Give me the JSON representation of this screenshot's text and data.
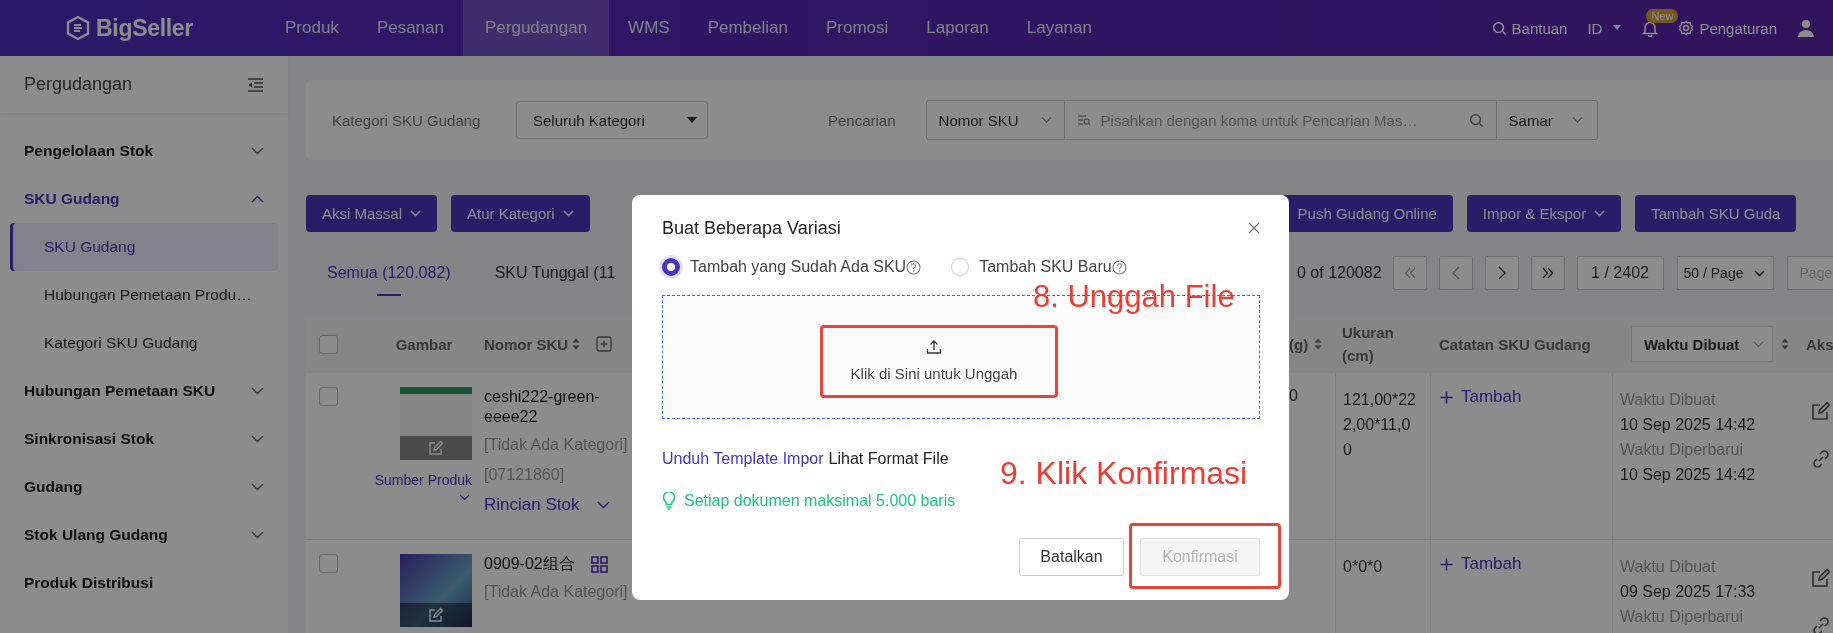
{
  "nav": {
    "logo": "BigSeller",
    "items": [
      {
        "label": "Produk",
        "selected": false
      },
      {
        "label": "Pesanan",
        "selected": false
      },
      {
        "label": "Pergudangan",
        "selected": true
      },
      {
        "label": "WMS",
        "selected": false
      },
      {
        "label": "Pembelian",
        "selected": false
      },
      {
        "label": "Promosi",
        "selected": false
      },
      {
        "label": "Laporan",
        "selected": false
      },
      {
        "label": "Layanan",
        "selected": false
      }
    ],
    "help": "Bantuan",
    "language": "ID",
    "notification_badge": "New",
    "settings": "Pengaturan"
  },
  "sidebar": {
    "title": "Pergudangan",
    "items": [
      {
        "kind": "group",
        "label": "Pengelolaan Stok",
        "expanded": false
      },
      {
        "kind": "group",
        "label": "SKU Gudang",
        "expanded": true,
        "children": [
          {
            "label": "SKU Gudang",
            "selected": true
          },
          {
            "label": "Hubungan Pemetaan Produ…",
            "selected": false
          },
          {
            "label": "Kategori SKU Gudang",
            "selected": false
          }
        ]
      },
      {
        "kind": "group",
        "label": "Hubungan Pemetaan SKU",
        "expanded": false
      },
      {
        "kind": "group",
        "label": "Sinkronisasi Stok",
        "expanded": false
      },
      {
        "kind": "group",
        "label": "Gudang",
        "expanded": false
      },
      {
        "kind": "group",
        "label": "Stok Ulang Gudang",
        "expanded": false
      },
      {
        "kind": "link",
        "label": "Produk Distribusi"
      }
    ]
  },
  "filters": {
    "category_label": "Kategori SKU Gudang",
    "category_value": "Seluruh Kategori",
    "search_label": "Pencarian",
    "search_field": "Nomor SKU",
    "search_placeholder": "Pisahkan dengan koma untuk Pencarian Mas…",
    "match_mode": "Samar"
  },
  "toolbar": {
    "left": [
      {
        "label": "Aksi Massal",
        "dropdown": true
      },
      {
        "label": "Atur Kategori",
        "dropdown": true
      }
    ],
    "right": [
      {
        "label": "Push Gudang Online",
        "dropdown": false
      },
      {
        "label": "Impor & Ekspor",
        "dropdown": true
      },
      {
        "label": "Tambah SKU Guda",
        "dropdown": false
      }
    ]
  },
  "tabs": [
    {
      "label": "Semua (120.082)",
      "selected": true
    },
    {
      "label": "SKU Tunggal (11",
      "selected": false
    }
  ],
  "pagination": {
    "range": "0 of 120082",
    "page": "1 / 2402",
    "page_size": "50 / Page",
    "jump_placeholder": "Page"
  },
  "table": {
    "all_checked": false,
    "columns": [
      "Gambar",
      "Nomor SKU",
      "(g)",
      "Ukuran (cm)",
      "Catatan SKU Gudang",
      "Waktu Dibuat",
      "Aks"
    ],
    "rows": [
      {
        "checked": false,
        "image_link": "Sumber Produk",
        "sku": "ceshi222-green-eeee22",
        "combo": false,
        "category": "[Tidak Ada Kategori]",
        "code": "[07121860]",
        "stock_link": "Rincian Stok",
        "weight": "0",
        "size": "121,00*222,00*11,00",
        "note_action": "Tambah",
        "times": [
          {
            "label": "Waktu Dibuat",
            "value": "10 Sep 2025 14:42"
          },
          {
            "label": "Waktu Diperbarui",
            "value": "10 Sep 2025 14:42"
          }
        ]
      },
      {
        "checked": false,
        "sku": "0909-02组合",
        "combo": true,
        "category": "[Tidak Ada Kategori]",
        "size": "0*0*0",
        "note_action": "Tambah",
        "times": [
          {
            "label": "Waktu Dibuat",
            "value": "09 Sep 2025 17:33"
          },
          {
            "label": "Waktu Diperbarui"
          }
        ]
      }
    ]
  },
  "dialog": {
    "title": "Buat Beberapa Variasi",
    "options": [
      {
        "label": "Tambah yang Sudah Ada SKU",
        "selected": true
      },
      {
        "label": "Tambah SKU Baru",
        "selected": false
      }
    ],
    "upload_text": "Klik di Sini untuk Unggah",
    "template_link": "Unduh Template Impor",
    "format_link": "Lihat Format File",
    "tip": "Setiap dokumen maksimal 5.000 baris",
    "cancel": "Batalkan",
    "confirm": {
      "label": "Konfirmasi",
      "disabled": true
    }
  },
  "annotations": [
    {
      "text": "8. Unggah File"
    },
    {
      "text": "9. Klik Konfirmasi"
    }
  ]
}
